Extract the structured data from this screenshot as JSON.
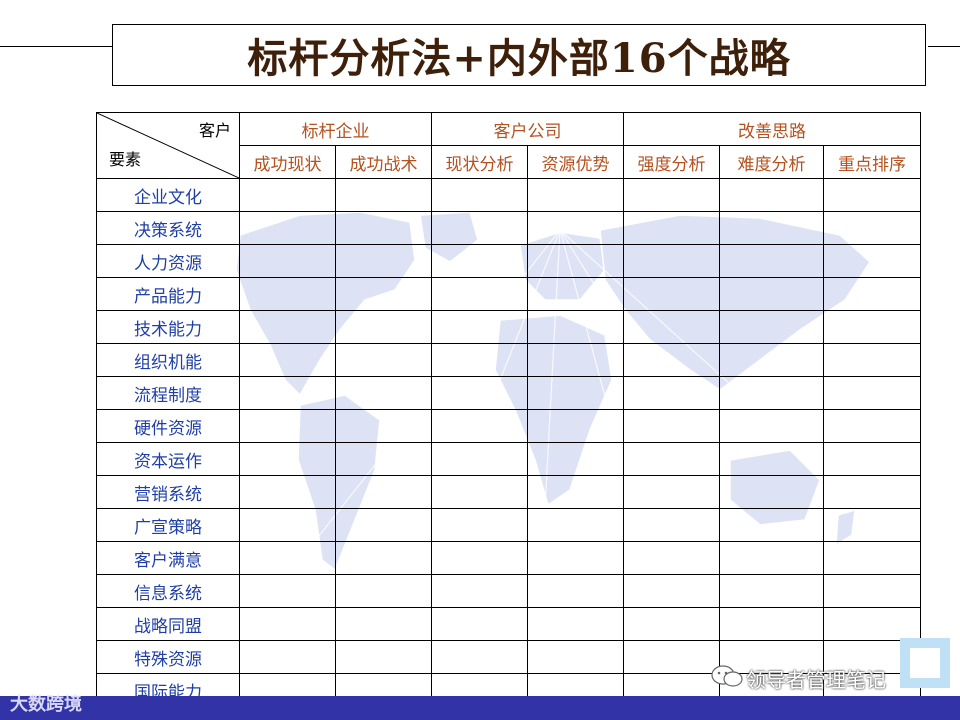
{
  "title": "标杆分析法+内外部16个战略",
  "table": {
    "corner_top": "客户",
    "corner_bottom": "要素",
    "groups": [
      "标杆企业",
      "客户公司",
      "改善思路"
    ],
    "columns": [
      "成功现状",
      "成功战术",
      "现状分析",
      "资源优势",
      "强度分析",
      "难度分析",
      "重点排序"
    ],
    "rows": [
      "企业文化",
      "决策系统",
      "人力资源",
      "产品能力",
      "技术能力",
      "组织机能",
      "流程制度",
      "硬件资源",
      "资本运作",
      "营销系统",
      "广宣策略",
      "客户满意",
      "信息系统",
      "战略同盟",
      "特殊资源",
      "国际能力"
    ]
  },
  "watermark": "领导者管理笔记",
  "logo": "大数跨境",
  "colors": {
    "title": "#3d1f0a",
    "header": "#b4511e",
    "row_label": "#1f3fa7",
    "bottom_bar": "#3333a8",
    "map": "#dde3f5"
  }
}
